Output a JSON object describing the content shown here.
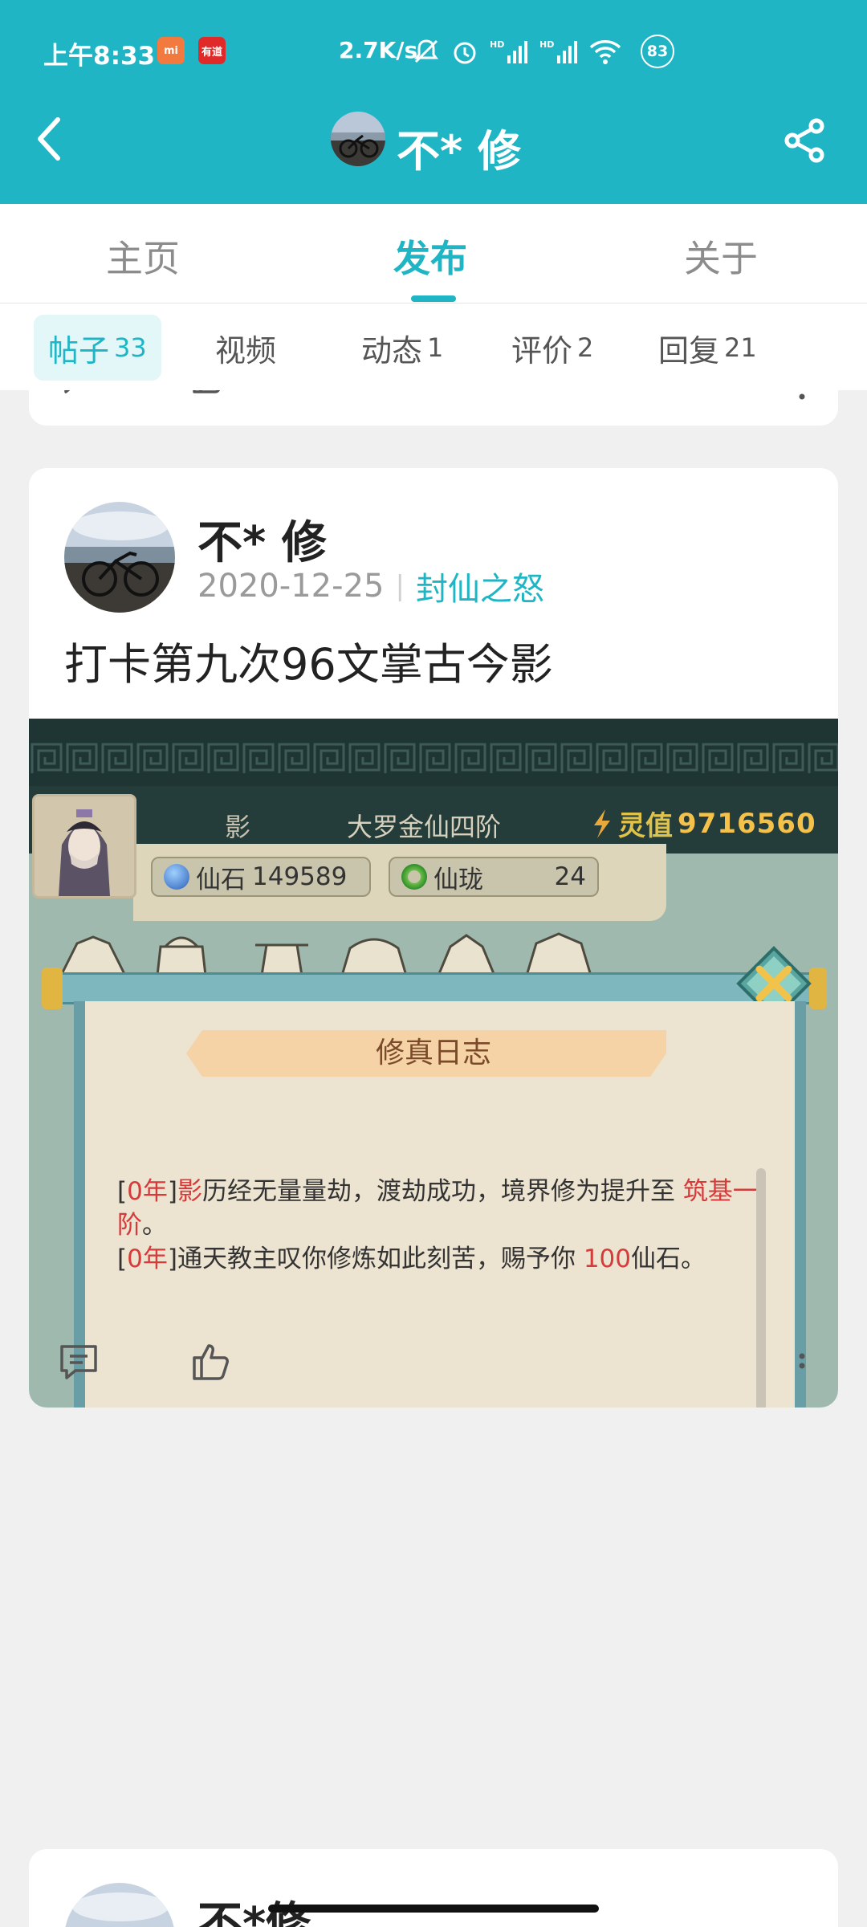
{
  "status_bar": {
    "time": "上午8:33",
    "mi_badge": "mi",
    "youdao_badge": "有道",
    "net_speed": "2.7K/s",
    "battery": "83"
  },
  "header": {
    "title": "不* 修"
  },
  "main_tabs": [
    {
      "label": "主页"
    },
    {
      "label": "发布"
    },
    {
      "label": "关于"
    }
  ],
  "sub_tabs": [
    {
      "label": "帖子",
      "count": "33"
    },
    {
      "label": "视频",
      "count": ""
    },
    {
      "label": "动态",
      "count": "1"
    },
    {
      "label": "评价",
      "count": "2"
    },
    {
      "label": "回复",
      "count": "21"
    }
  ],
  "post": {
    "author": "不* 修",
    "date": "2020-12-25",
    "game": "封仙之怒",
    "title": "打卡第九次96文掌古今影",
    "screenshot": {
      "player_name": "影",
      "realm": "大罗金仙四阶",
      "ling_label": "灵值",
      "ling_value": "9716560",
      "xianshi_label": "仙石",
      "xianshi_value": "149589",
      "xianlong_label": "仙珑",
      "xianlong_value": "24",
      "log_title": "修真日志",
      "log_lines": [
        {
          "year": "0年",
          "name": "影",
          "text": "历经无量量劫，渡劫成功，境界修为提升至",
          "realm": "筑基一阶",
          "end": "。"
        },
        {
          "year": "0年",
          "text_a": "通天教主叹你修炼如此刻苦，赐予你",
          "amount": "100",
          "text_b": "仙石。"
        }
      ]
    }
  },
  "next_post": {
    "author": "不*修"
  },
  "icons": [
    "back-icon",
    "share-icon",
    "comment-icon",
    "like-icon",
    "more-icon"
  ],
  "colors": {
    "accent": "#1fb5c4",
    "background": "#f0f0f0"
  }
}
